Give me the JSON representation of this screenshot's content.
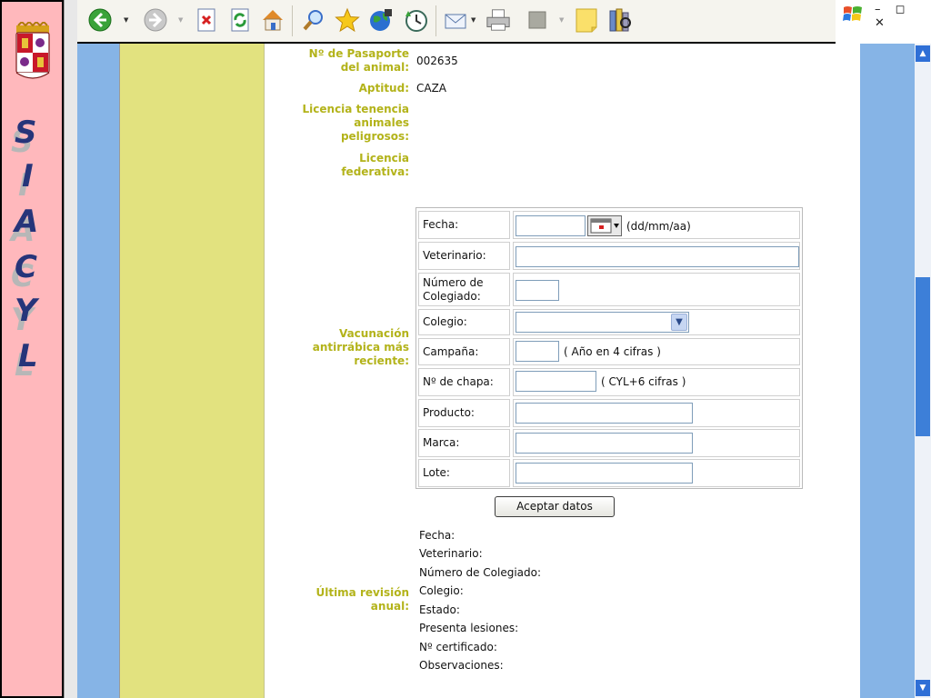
{
  "sidebar": {
    "letters": [
      "S",
      "I",
      "A",
      "C",
      "Y",
      "L"
    ]
  },
  "toolbar": {
    "icons": [
      "back-icon",
      "forward-icon",
      "stop-icon",
      "refresh-icon",
      "home-icon",
      "search-icon",
      "favorites-icon",
      "media-icon",
      "history-icon",
      "mail-icon",
      "print-icon",
      "edit-icon",
      "discuss-icon",
      "research-icon"
    ]
  },
  "window": {
    "controls": "– ◻ ✕"
  },
  "animal": {
    "passport_label": "Nº de Pasaporte del animal:",
    "passport_value": "002635",
    "aptitud_label": "Aptitud:",
    "aptitud_value": "CAZA",
    "licencia_peligrosos_label": "Licencia tenencia animales peligrosos:",
    "licencia_federativa_label": "Licencia federativa:"
  },
  "vacunacion": {
    "section_label": "Vacunación antirrábica más reciente:",
    "fecha_label": "Fecha:",
    "fecha_value": "",
    "fecha_hint": "(dd/mm/aa)",
    "veterinario_label": "Veterinario:",
    "veterinario_value": "",
    "numero_colegiado_label": "Número de Colegiado:",
    "numero_colegiado_value": "",
    "colegio_label": "Colegio:",
    "colegio_value": "",
    "campana_label": "Campaña:",
    "campana_value": "",
    "campana_hint": "( Año en 4 cifras )",
    "chapa_label": "Nº de chapa:",
    "chapa_value": "",
    "chapa_hint": "( CYL+6 cifras )",
    "producto_label": "Producto:",
    "producto_value": "",
    "marca_label": "Marca:",
    "marca_value": "",
    "lote_label": "Lote:",
    "lote_value": "",
    "submit_label": "Aceptar datos"
  },
  "revision": {
    "section_label": "Última revisión anual:",
    "fields": [
      "Fecha:",
      "Veterinario:",
      "Número de Colegiado:",
      "Colegio:",
      "Estado:",
      "Presenta lesiones:",
      "Nº certificado:",
      "Observaciones:"
    ]
  },
  "colors": {
    "label_olive": "#b3b31a",
    "page_blue": "#86b4e6",
    "page_yellow": "#e2e27f",
    "sidebar_pink": "#ffb8bc"
  }
}
